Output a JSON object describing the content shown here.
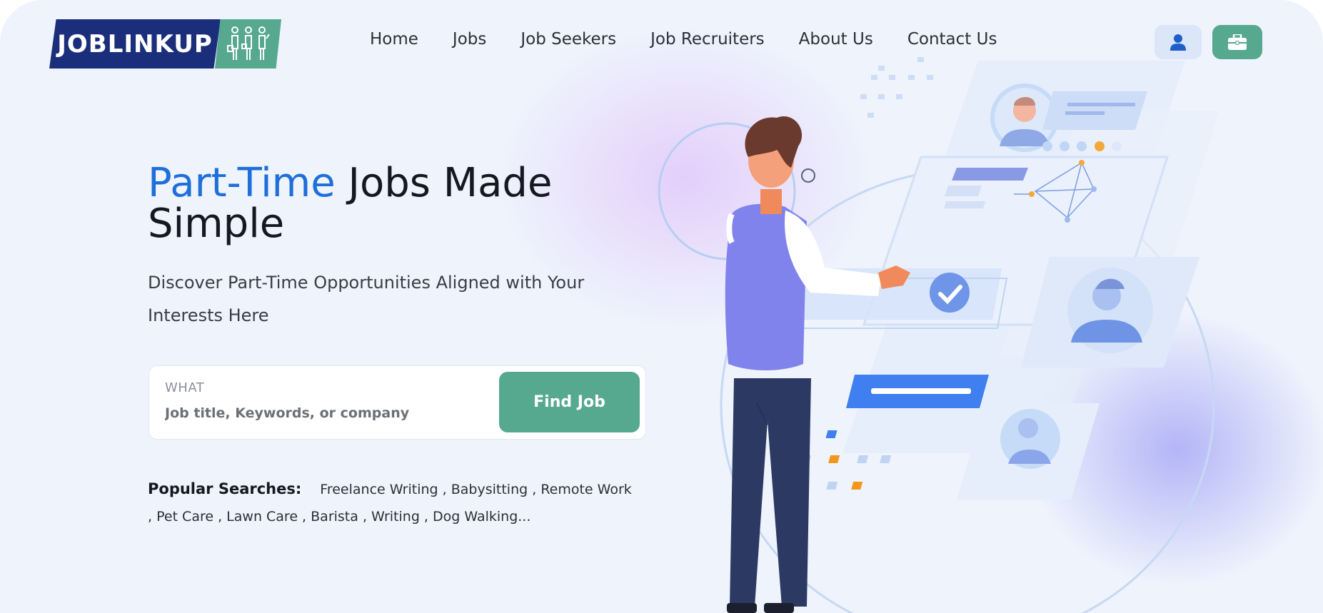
{
  "header": {
    "logo_text": "JOBLINKUP",
    "nav": [
      {
        "label": "Home"
      },
      {
        "label": "Jobs"
      },
      {
        "label": "Job Seekers"
      },
      {
        "label": "Job Recruiters"
      },
      {
        "label": "About Us"
      },
      {
        "label": "Contact Us"
      }
    ],
    "user_icon": "user-icon",
    "briefcase_icon": "briefcase-icon"
  },
  "hero": {
    "title_highlight": "Part-Time",
    "title_rest": " Jobs Made Simple",
    "subtitle": "Discover Part-Time Opportunities Aligned with Your Interests Here"
  },
  "search": {
    "label": "WHAT",
    "placeholder": "Job title, Keywords, or company",
    "value": "",
    "button_label": "Find Job"
  },
  "popular": {
    "label": "Popular Searches:",
    "items": [
      "Freelance Writing",
      "Babysitting",
      "Remote Work",
      "Pet Care",
      "Lawn Care",
      "Barista",
      "Writing",
      "Dog Walking..."
    ]
  },
  "colors": {
    "brand_blue": "#1a2e7c",
    "brand_green": "#56a88f",
    "highlight_blue": "#1e6fd9",
    "background": "#eef3fc"
  }
}
